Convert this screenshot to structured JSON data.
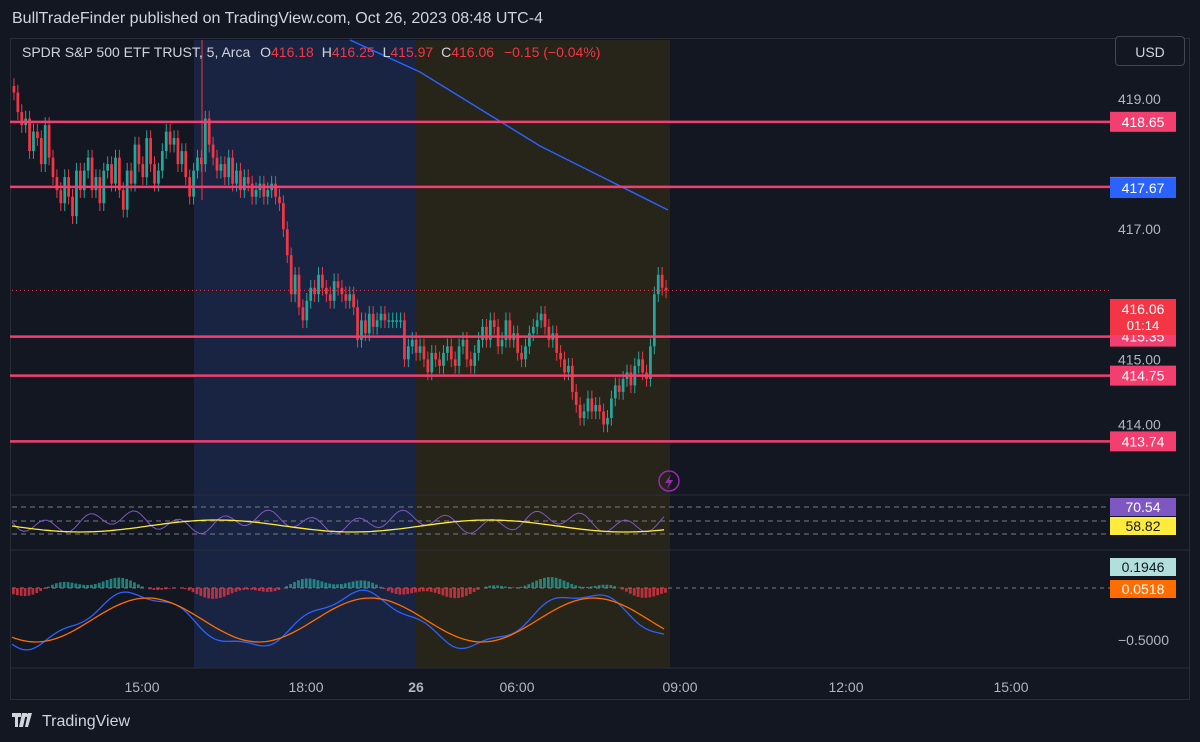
{
  "publisher_line": "BullTradeFinder published on TradingView.com, Oct 26, 2023 08:48 UTC-4",
  "legend": {
    "symbol": "SPDR S&P 500 ETF TRUST, 5, Arca",
    "o_label": "O",
    "o_value": "416.18",
    "h_label": "H",
    "h_value": "416.25",
    "l_label": "L",
    "l_value": "415.97",
    "c_label": "C",
    "c_value": "416.06",
    "change": "−0.15 (−0.04%)"
  },
  "currency_button": "USD",
  "footer_brand": "TradingView",
  "colors": {
    "background": "#131722",
    "up": "#26a69a",
    "down": "#f23645",
    "level_line": "#f23f6f",
    "ma_line": "#2962ff",
    "rsi_line": "#7e57c2",
    "rsi_signal": "#ffeb3b",
    "macd_line": "#2962ff",
    "signal_line": "#ff6d00",
    "ext_session": "#1c2a4d",
    "pre_session": "#2b2719"
  },
  "chart_data": {
    "type": "candlestick",
    "x_ticks": [
      "15:00",
      "18:00",
      "26",
      "06:00",
      "09:00",
      "12:00",
      "15:00"
    ],
    "y_ticks": [
      "419.00",
      "417.00",
      "415.00",
      "414.00"
    ],
    "ylim": [
      413.3,
      419.6
    ],
    "levels": [
      {
        "value": 418.65,
        "label": "418.65"
      },
      {
        "value": 417.65,
        "label": "417.65"
      },
      {
        "value": 415.35,
        "label": "415.35"
      },
      {
        "value": 414.75,
        "label": "414.75"
      },
      {
        "value": 413.74,
        "label": "413.74"
      }
    ],
    "ma_label": "417.67",
    "last_price_label": "416.06",
    "countdown": "01:14",
    "closes": [
      419.1,
      418.8,
      418.6,
      418.7,
      418.2,
      418.5,
      418.4,
      418.0,
      418.6,
      418.1,
      417.8,
      417.6,
      417.4,
      417.8,
      417.5,
      417.2,
      417.9,
      417.6,
      417.9,
      418.1,
      417.6,
      417.8,
      417.4,
      417.9,
      418.0,
      417.7,
      418.1,
      417.6,
      417.3,
      417.9,
      417.7,
      418.3,
      418.0,
      417.8,
      418.4,
      418.0,
      417.7,
      417.9,
      418.2,
      418.5,
      418.3,
      418.4,
      418.0,
      418.2,
      417.8,
      417.5,
      417.9,
      418.1,
      418.0,
      418.7,
      418.3,
      418.1,
      417.9,
      418.0,
      417.8,
      418.1,
      417.7,
      417.9,
      417.6,
      417.8,
      417.7,
      417.5,
      417.6,
      417.7,
      417.5,
      417.6,
      417.7,
      417.5,
      417.4,
      417.0,
      416.6,
      416.0,
      416.3,
      415.8,
      415.6,
      415.9,
      416.1,
      416.0,
      416.3,
      416.1,
      416.0,
      415.9,
      416.2,
      416.1,
      416.0,
      415.9,
      416.0,
      415.8,
      415.3,
      415.6,
      415.4,
      415.7,
      415.5,
      415.6,
      415.7,
      415.6,
      415.6,
      415.6,
      415.6,
      415.6,
      415.0,
      415.2,
      415.3,
      415.1,
      415.2,
      415.0,
      414.8,
      415.1,
      415.0,
      414.9,
      415.1,
      415.2,
      415.0,
      414.9,
      415.2,
      415.3,
      415.0,
      414.9,
      415.1,
      415.3,
      415.5,
      415.3,
      415.6,
      415.5,
      415.2,
      415.3,
      415.6,
      415.3,
      415.4,
      415.1,
      415.0,
      415.2,
      415.4,
      415.5,
      415.6,
      415.7,
      415.5,
      415.3,
      415.4,
      415.1,
      415.0,
      414.8,
      414.9,
      414.5,
      414.3,
      414.1,
      414.2,
      414.4,
      414.2,
      414.3,
      414.2,
      414.0,
      414.1,
      414.4,
      414.6,
      414.5,
      414.7,
      414.8,
      414.6,
      414.9,
      415.0,
      414.8,
      414.7,
      415.2,
      416.0,
      416.3,
      416.1,
      416.06
    ]
  }
}
